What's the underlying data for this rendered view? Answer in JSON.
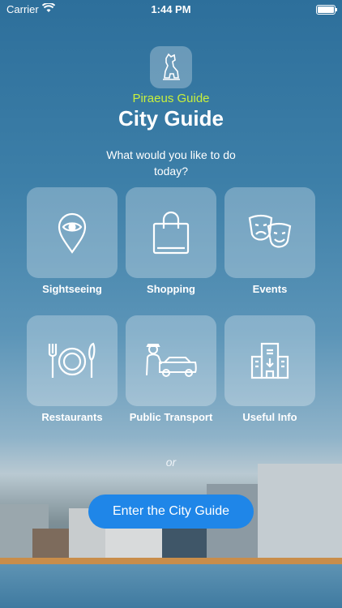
{
  "status_bar": {
    "carrier": "Carrier",
    "time": "1:44 PM"
  },
  "header": {
    "subtitle": "Piraeus Guide",
    "title": "City Guide",
    "prompt": "What would you like to do today?"
  },
  "menu": [
    {
      "label": "Sightseeing",
      "icon": "location-eye-icon"
    },
    {
      "label": "Shopping",
      "icon": "shopping-bag-icon"
    },
    {
      "label": "Events",
      "icon": "theater-masks-icon"
    },
    {
      "label": "Restaurants",
      "icon": "plate-cutlery-icon"
    },
    {
      "label": "Public Transport",
      "icon": "chauffeur-car-icon"
    },
    {
      "label": "Useful Info",
      "icon": "building-info-icon"
    }
  ],
  "divider_text": "or",
  "cta_label": "Enter the City Guide",
  "colors": {
    "accent_green": "#c8f03c",
    "button_blue": "#1f86e8"
  }
}
